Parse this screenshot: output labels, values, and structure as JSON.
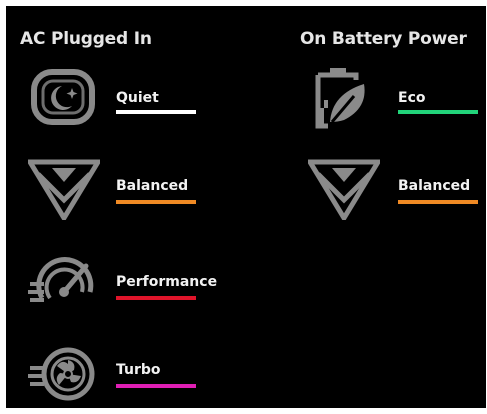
{
  "headers": {
    "ac": "AC Plugged In",
    "battery": "On Battery Power"
  },
  "ac_modes": [
    {
      "label": "Quiet",
      "icon": "quiet-moon-icon",
      "color": "#ffffff"
    },
    {
      "label": "Balanced",
      "icon": "balanced-chevron-icon",
      "color": "#f08a24"
    },
    {
      "label": "Performance",
      "icon": "performance-gauge-icon",
      "color": "#e0142a"
    },
    {
      "label": "Turbo",
      "icon": "turbo-fan-icon",
      "color": "#e01fb4"
    }
  ],
  "battery_modes": [
    {
      "label": "Eco",
      "icon": "eco-leaf-battery-icon",
      "color": "#22d47a"
    },
    {
      "label": "Balanced",
      "icon": "balanced-chevron-icon",
      "color": "#f08a24"
    }
  ]
}
